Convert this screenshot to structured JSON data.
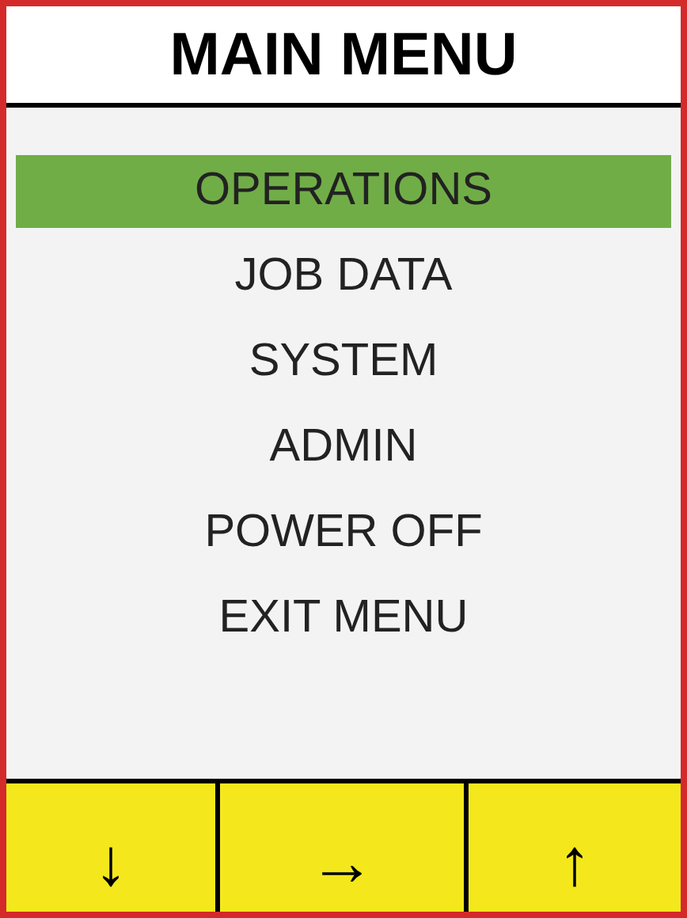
{
  "title": "MAIN MENU",
  "menu": [
    {
      "label": "OPERATIONS",
      "selected": true
    },
    {
      "label": "JOB DATA",
      "selected": false
    },
    {
      "label": "SYSTEM",
      "selected": false
    },
    {
      "label": "ADMIN",
      "selected": false
    },
    {
      "label": "POWER OFF",
      "selected": false
    },
    {
      "label": "EXIT MENU",
      "selected": false
    }
  ],
  "keys": [
    "↓",
    "→",
    "↑"
  ]
}
